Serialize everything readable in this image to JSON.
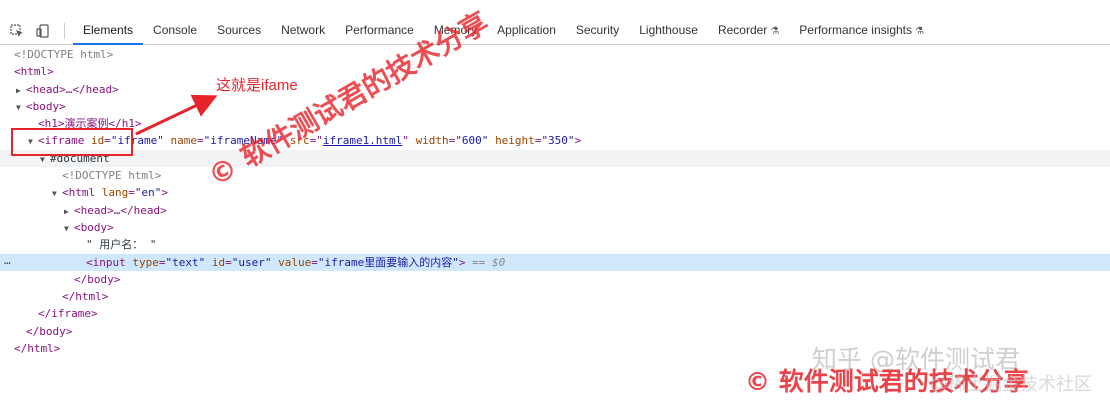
{
  "toolbar": {
    "tabs": [
      "Elements",
      "Console",
      "Sources",
      "Network",
      "Performance",
      "Memory",
      "Application",
      "Security",
      "Lighthouse",
      "Recorder",
      "Performance insights"
    ],
    "flask_glyph": "⚗"
  },
  "tree": {
    "doctype": "<!DOCTYPE html>",
    "html_open": "<html>",
    "head_collapsed": "<head>…</head>",
    "body_open": "<body>",
    "h1": "<h1>演示案例</h1>",
    "iframe_open_tag": "<iframe",
    "iframe_attr_id": "id",
    "iframe_val_id": "\"iframe\"",
    "iframe_attr_name": "name",
    "iframe_val_name": "\"iframeName\"",
    "iframe_attr_src": "src",
    "iframe_val_src": "iframe1.html",
    "iframe_attr_width": "width",
    "iframe_val_width": "\"600\"",
    "iframe_attr_height": "height",
    "iframe_val_height": "\"350\"",
    "iframe_close_bracket": ">",
    "document_node": "#document",
    "inner_doctype": "<!DOCTYPE html>",
    "inner_html_open": "<html",
    "inner_html_attr_lang": "lang",
    "inner_html_val_lang": "\"en\"",
    "inner_head": "<head>…</head>",
    "inner_body_open": "<body>",
    "text_node": "\" 用户名： \"",
    "input_open": "<input",
    "input_attr_type": "type",
    "input_val_type": "\"text\"",
    "input_attr_id": "id",
    "input_val_id": "\"user\"",
    "input_attr_value": "value",
    "input_val_value": "\"iframe里面要输入的内容\"",
    "input_close": ">",
    "input_eq": "== $0",
    "inner_body_close": "</body>",
    "inner_html_close": "</html>",
    "iframe_close": "</iframe>",
    "body_close": "</body>",
    "html_close": "</html>",
    "ellipsis": "…"
  },
  "annotation": {
    "label": "这就是ifame",
    "arrow_color": "#e8232a"
  },
  "watermarks": {
    "diagonal": "© 软件测试君的技术分享",
    "bottom": "© 软件测试君的技术分享",
    "zhihu": "知乎 @软件测试君",
    "juejin": "@稀土掘金技术社区"
  }
}
